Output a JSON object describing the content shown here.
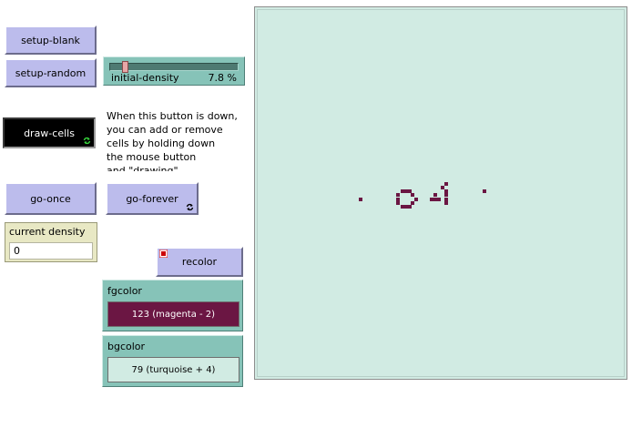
{
  "buttons": {
    "setup_blank": "setup-blank",
    "setup_random": "setup-random",
    "draw_cells": "draw-cells",
    "go_once": "go-once",
    "go_forever": "go-forever",
    "recolor": "recolor"
  },
  "slider": {
    "label": "initial-density",
    "value": "7.8 %",
    "fraction": 0.078
  },
  "note": {
    "lines": [
      "When this button is down,",
      "you can add or remove",
      "cells by holding down",
      "the mouse button",
      "and \"drawing\"."
    ]
  },
  "monitor": {
    "label": "current density",
    "value": "0"
  },
  "fgcolor": {
    "label": "fgcolor",
    "value": "123 (magenta - 2)",
    "color": "#6b1643"
  },
  "bgcolor": {
    "label": "bgcolor",
    "value": "79 (turquoise + 4)",
    "color": "#d1ebe3"
  },
  "world": {
    "background": "#d1ebe3",
    "cell_color": "#6b1643"
  },
  "icons": [
    "forever-icon",
    "error-icon"
  ]
}
